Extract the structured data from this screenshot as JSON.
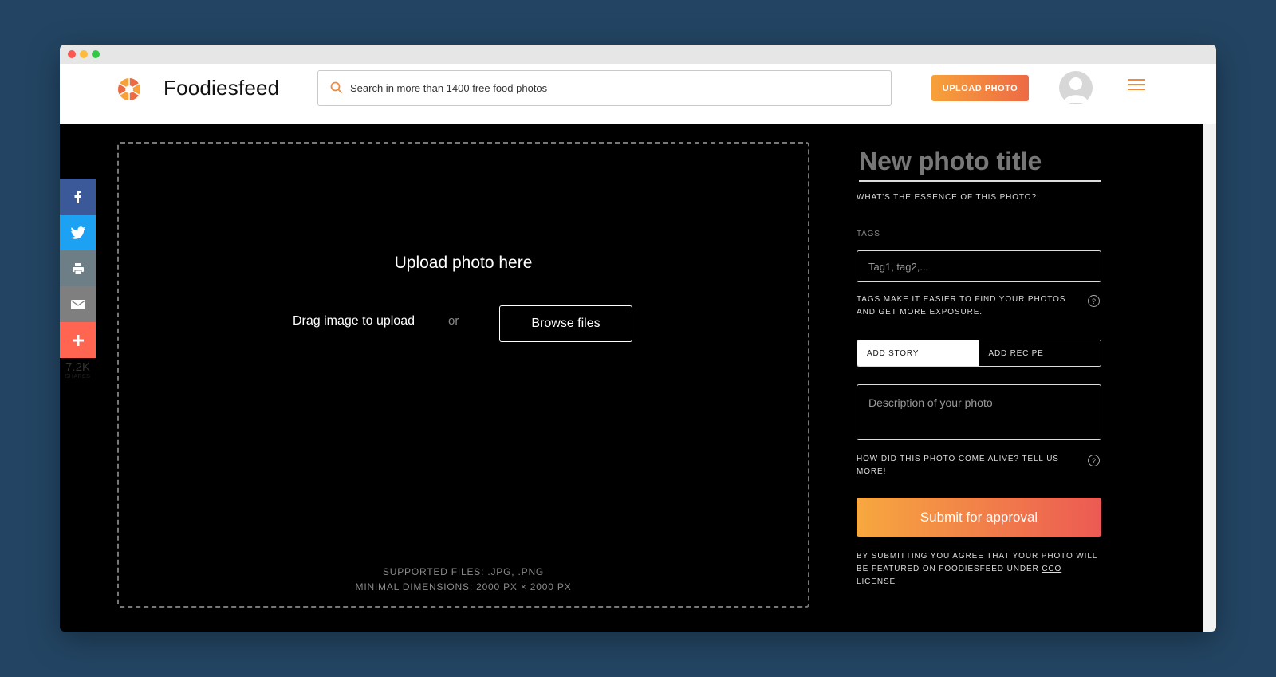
{
  "header": {
    "logo_text": "Foodiesfeed",
    "search_placeholder": "Search in more than 1400 free food photos",
    "upload_button": "UPLOAD PHOTO"
  },
  "share": {
    "count": "7.2K",
    "label": "SHARES",
    "icons": [
      "facebook-icon",
      "twitter-icon",
      "print-icon",
      "email-icon",
      "plus-icon"
    ]
  },
  "dropzone": {
    "title": "Upload photo here",
    "drag_text": "Drag image to upload",
    "or_text": "or",
    "browse_button": "Browse files",
    "supported": "SUPPORTED FILES: .JPG, .PNG",
    "dimensions": "MINIMAL DIMENSIONS: 2000 PX × 2000 PX"
  },
  "form": {
    "title_placeholder": "New photo title",
    "essence_question": "WHAT'S THE ESSENCE OF THIS PHOTO?",
    "tags_label": "TAGS",
    "tags_placeholder": "Tag1, tag2,...",
    "tags_help": "TAGS MAKE IT EASIER TO FIND YOUR PHOTOS AND GET MORE EXPOSURE.",
    "tabs": [
      {
        "label": "ADD STORY",
        "active": true
      },
      {
        "label": "ADD RECIPE",
        "active": false
      }
    ],
    "description_placeholder": "Description of your photo",
    "description_help": "HOW DID THIS PHOTO COME ALIVE? TELL US MORE!",
    "submit_button": "Submit for approval",
    "agree_text": "BY SUBMITTING YOU AGREE THAT YOUR PHOTO WILL BE FEATURED ON FOODIESFEED UNDER ",
    "license_link": "CCO LICENSE"
  },
  "colors": {
    "background": "#234563",
    "accent_start": "#f7a13a",
    "accent_end": "#ee6a45",
    "facebook": "#3b5998",
    "twitter": "#1da1f2",
    "print": "#6d7e86",
    "email": "#7f7f7f",
    "more": "#ff6550"
  }
}
